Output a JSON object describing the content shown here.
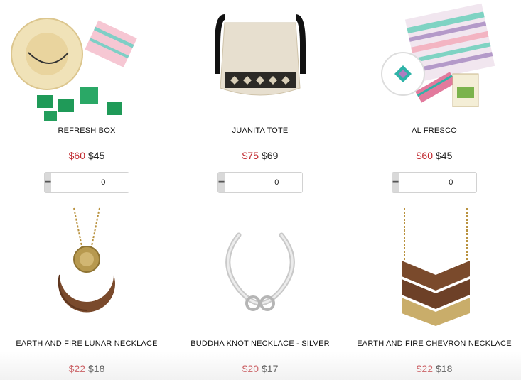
{
  "products": [
    {
      "name": "REFRESH BOX",
      "old_price": "$60",
      "price": "$45",
      "qty": "0",
      "image": "refresh-box-image",
      "minus": "−",
      "plus": "+"
    },
    {
      "name": "JUANITA TOTE",
      "old_price": "$75",
      "price": "$69",
      "qty": "0",
      "image": "juanita-tote-image",
      "minus": "−",
      "plus": "+"
    },
    {
      "name": "AL FRESCO",
      "old_price": "$60",
      "price": "$45",
      "qty": "0",
      "image": "al-fresco-image",
      "minus": "−",
      "plus": "+"
    },
    {
      "name": "EARTH AND FIRE LUNAR NECKLACE",
      "old_price": "$22",
      "price": "$18",
      "image": "lunar-necklace-image"
    },
    {
      "name": "BUDDHA KNOT NECKLACE - SILVER",
      "old_price": "$20",
      "price": "$17",
      "image": "buddha-knot-necklace-image"
    },
    {
      "name": "EARTH AND FIRE CHEVRON NECKLACE",
      "old_price": "$22",
      "price": "$18",
      "image": "chevron-necklace-image"
    }
  ],
  "colors": {
    "sale_red": "#c0272d",
    "stepper_gray": "#d9d9d9"
  }
}
